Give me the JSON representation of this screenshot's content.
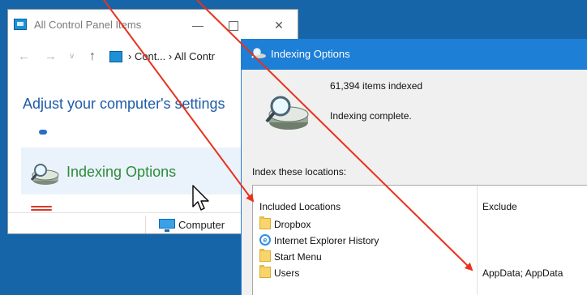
{
  "cp_window": {
    "title": "All Control Panel Items",
    "breadcrumb": "›  Cont...  ›  All Contr",
    "heading": "Adjust your computer's settings",
    "item_label": "Indexing Options",
    "status_item": "Computer",
    "nav": {
      "back": "←",
      "forward": "→",
      "recent": "∨",
      "up": "↑"
    },
    "buttons": {
      "minimize": "—",
      "close": "✕"
    }
  },
  "io_window": {
    "title": "Indexing Options",
    "items_indexed": "61,394 items indexed",
    "status": "Indexing complete.",
    "index_locations_label": "Index these locations:",
    "columns": {
      "included": "Included Locations",
      "exclude": "Exclude"
    },
    "locations": [
      {
        "name": "Dropbox",
        "icon": "folder-icon",
        "exclude": ""
      },
      {
        "name": "Internet Explorer History",
        "icon": "ie-icon",
        "exclude": ""
      },
      {
        "name": "Start Menu",
        "icon": "folder-icon",
        "exclude": ""
      },
      {
        "name": "Users",
        "icon": "folder-icon",
        "exclude": "AppData; AppData"
      }
    ]
  },
  "colors": {
    "desktop": "#1565a8",
    "titlebar_active": "#1d7fd6",
    "heading_blue": "#1e5ba8",
    "item_green": "#2e8b3b",
    "annotation_red": "#e8321e"
  },
  "ie_glyph": "e"
}
